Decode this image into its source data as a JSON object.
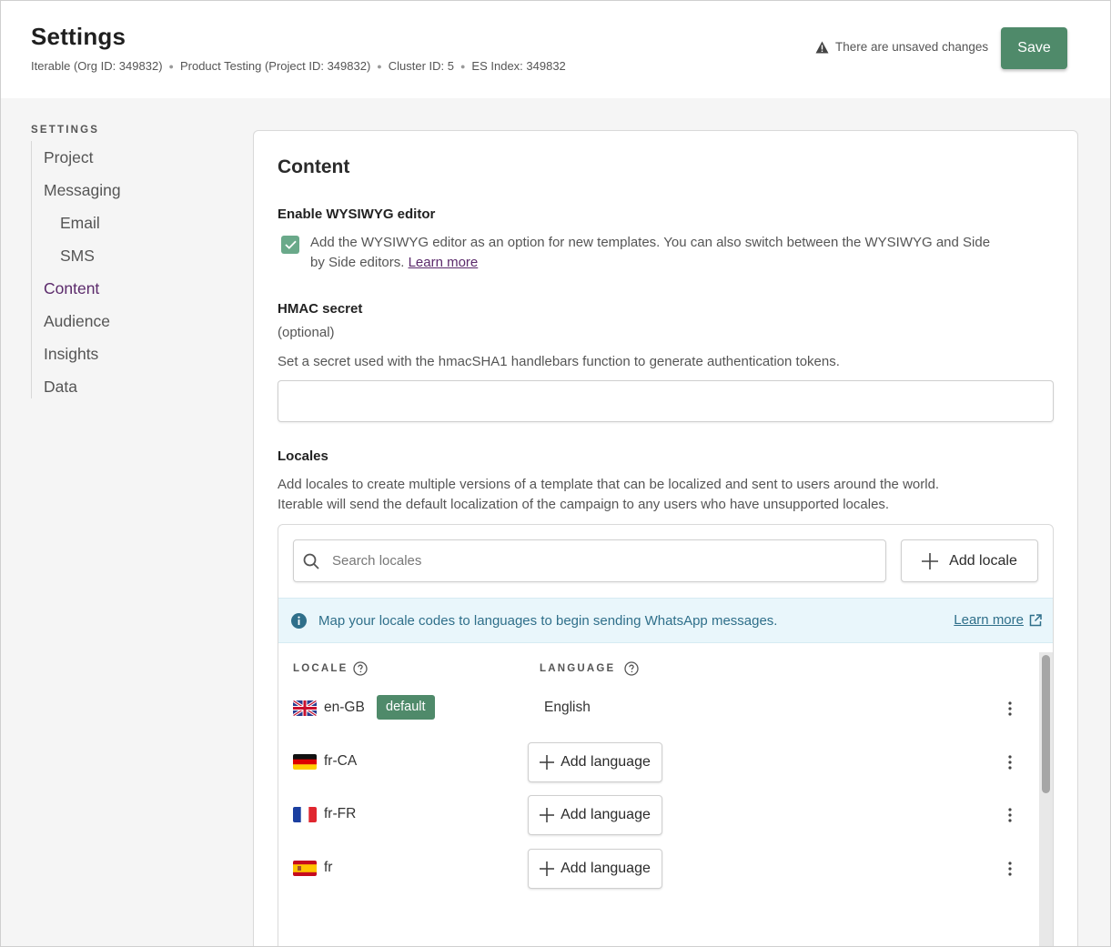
{
  "header": {
    "title": "Settings",
    "breadcrumb": [
      "Iterable (Org ID: 349832)",
      "Product Testing (Project ID: 349832)",
      "Cluster ID: 5",
      "ES Index: 349832"
    ],
    "unsaved_text": "There are unsaved changes",
    "save_label": "Save"
  },
  "sidebar": {
    "heading": "SETTINGS",
    "items": [
      {
        "label": "Project",
        "level": 0
      },
      {
        "label": "Messaging",
        "level": 0
      },
      {
        "label": "Email",
        "level": 1
      },
      {
        "label": "SMS",
        "level": 1
      },
      {
        "label": "Content",
        "level": 0,
        "active": true
      },
      {
        "label": "Audience",
        "level": 0
      },
      {
        "label": "Insights",
        "level": 0
      },
      {
        "label": "Data",
        "level": 0
      }
    ]
  },
  "content": {
    "title": "Content",
    "wysiwyg": {
      "label": "Enable WYSIWYG editor",
      "checked": true,
      "description_line1": "Add the WYSIWYG editor as an option for new templates. You can also switch between the WYSIWYG and Side",
      "description_line2": "by Side editors.",
      "learn_more": "Learn more"
    },
    "hmac": {
      "label": "HMAC secret",
      "optional": "(optional)",
      "description": "Set a secret used with the hmacSHA1 handlebars function to generate authentication tokens.",
      "value": "",
      "placeholder": ""
    },
    "locales": {
      "label": "Locales",
      "description_line1": "Add locales to create multiple versions of a template that can be localized and sent to users around the world.",
      "description_line2": "Iterable will send the default localization of the campaign to any users who have unsupported locales.",
      "search_placeholder": "Search locales",
      "add_locale_label": "Add locale",
      "banner_text": "Map your locale codes to languages to begin sending WhatsApp messages.",
      "banner_link": "Learn more",
      "col_locale": "LOCALE",
      "col_language": "LANGUAGE",
      "rows": [
        {
          "code": "en-GB",
          "badge": "default",
          "language": "English",
          "flag": "uk-flag-icon"
        },
        {
          "code": "fr-CA",
          "add_language": "Add language",
          "flag": "germany-flag-icon"
        },
        {
          "code": "fr-FR",
          "add_language": "Add language",
          "flag": "france-flag-icon"
        },
        {
          "code": "fr",
          "add_language": "Add language",
          "flag": "spain-flag-icon"
        }
      ]
    }
  },
  "colors": {
    "accent_green": "#4f8a6a",
    "active_nav": "#5b2a6b",
    "banner_bg": "#e9f6fb",
    "banner_text": "#2f6f8a"
  }
}
